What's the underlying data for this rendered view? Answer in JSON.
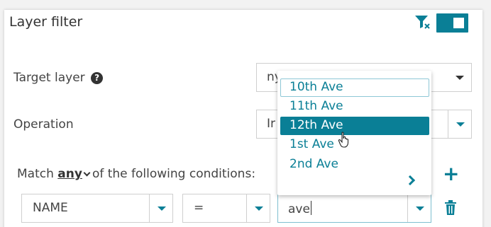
{
  "panel": {
    "title": "Layer filter",
    "toggle_on": true,
    "accent_color": "#0a7f96"
  },
  "target_layer": {
    "label": "Target layer",
    "help_icon": "?",
    "value": "ny"
  },
  "operation": {
    "label": "Operation",
    "value": "Ir"
  },
  "conditions": {
    "match_prefix": "Match",
    "match_mode": "any",
    "match_suffix": "of the following conditions:",
    "field": "NAME",
    "operator": "=",
    "value_input": "ave"
  },
  "dropdown": {
    "options": [
      "10th Ave",
      "11th Ave",
      "12th Ave",
      "1st Ave",
      "2nd Ave"
    ],
    "selected_index": 2,
    "outlined_index": 0
  },
  "icons": {
    "filter_clear": "filter-clear-icon",
    "add": "plus-icon",
    "delete": "trash-icon",
    "more": "chevron-right-icon"
  }
}
